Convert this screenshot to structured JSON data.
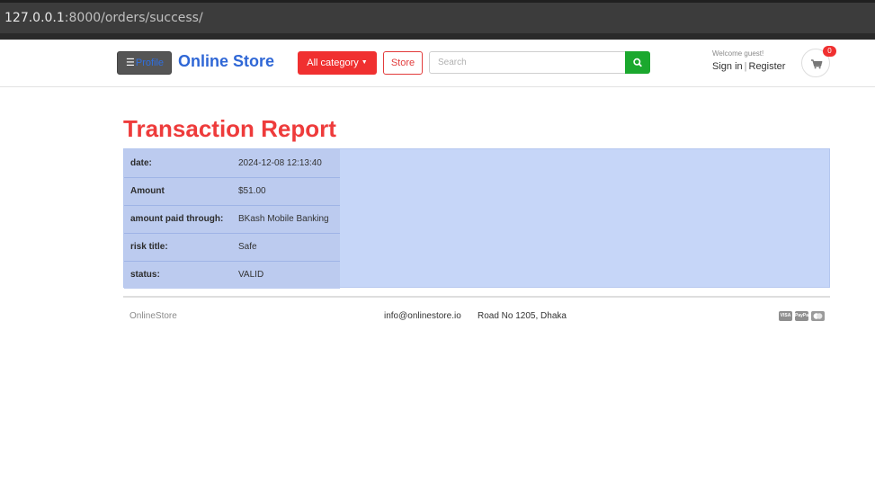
{
  "browser": {
    "url_host": "127.0.0.1",
    "url_rest": ":8000/orders/success/"
  },
  "header": {
    "profile_label": "Profile",
    "brand": "Online Store",
    "category_label": "All category",
    "store_label": "Store",
    "search_placeholder": "Search",
    "welcome": "Welcome guest!",
    "sign_in": "Sign in",
    "register": "Register",
    "cart_count": "0"
  },
  "report": {
    "title": "Transaction Report",
    "rows": [
      {
        "key": "date:",
        "value": "2024-12-08 12:13:40"
      },
      {
        "key": "Amount",
        "value": "$51.00"
      },
      {
        "key": "amount paid through:",
        "value": "BKash Mobile Banking"
      },
      {
        "key": "risk title:",
        "value": "Safe"
      },
      {
        "key": "status:",
        "value": "VALID"
      }
    ]
  },
  "footer": {
    "brand": "OnlineStore",
    "email": "info@onlinestore.io",
    "address": "Road No 1205, Dhaka",
    "payment_icons": [
      "visa-icon",
      "paypal-icon",
      "mastercard-icon"
    ],
    "visa": "VISA",
    "paypal": "PayPal"
  },
  "colors": {
    "accent_red": "#f03030",
    "brand_blue": "#2f67d6",
    "search_green": "#1ba82e",
    "report_bg": "#c6d6f8"
  }
}
